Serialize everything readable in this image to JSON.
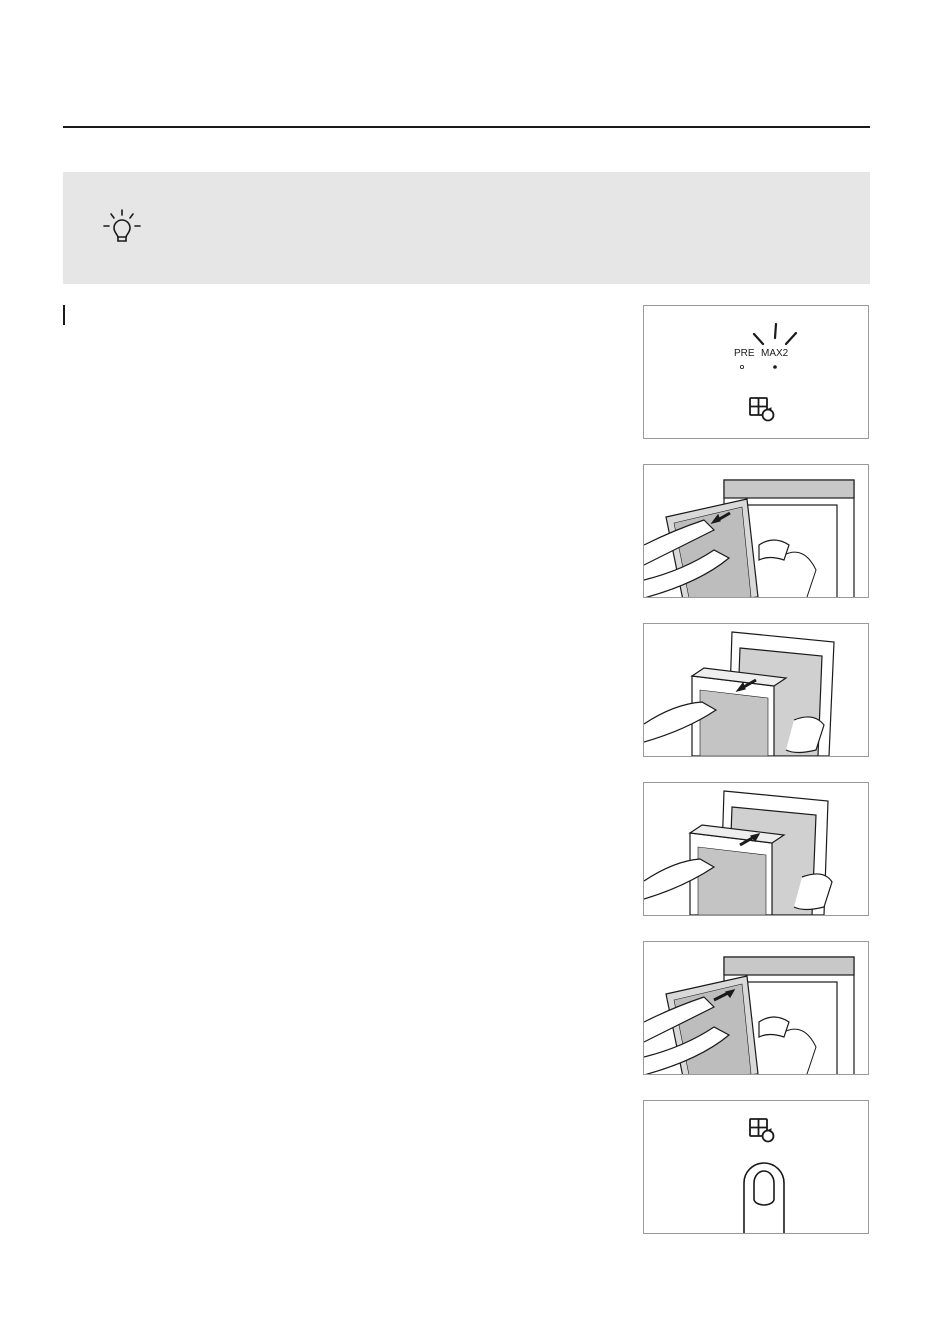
{
  "header": {
    "rule": "horizontal-divider"
  },
  "tip": {
    "icon": "lightbulb-icon",
    "background": "#e6e6e6"
  },
  "panels": [
    {
      "name": "filter-indicator-panel",
      "labels": {
        "pre": "PRE",
        "max2": "MAX2"
      },
      "icon": "filter-reset-icon"
    },
    {
      "name": "remove-front-cover-illustration"
    },
    {
      "name": "remove-filter-illustration"
    },
    {
      "name": "insert-filter-illustration"
    },
    {
      "name": "attach-front-cover-illustration"
    },
    {
      "name": "press-filter-reset-illustration",
      "icon": "filter-reset-icon"
    }
  ],
  "colors": {
    "line": "#1a1a1a",
    "panel_border": "#9a9a9a",
    "tip_bg": "#e6e6e6"
  }
}
